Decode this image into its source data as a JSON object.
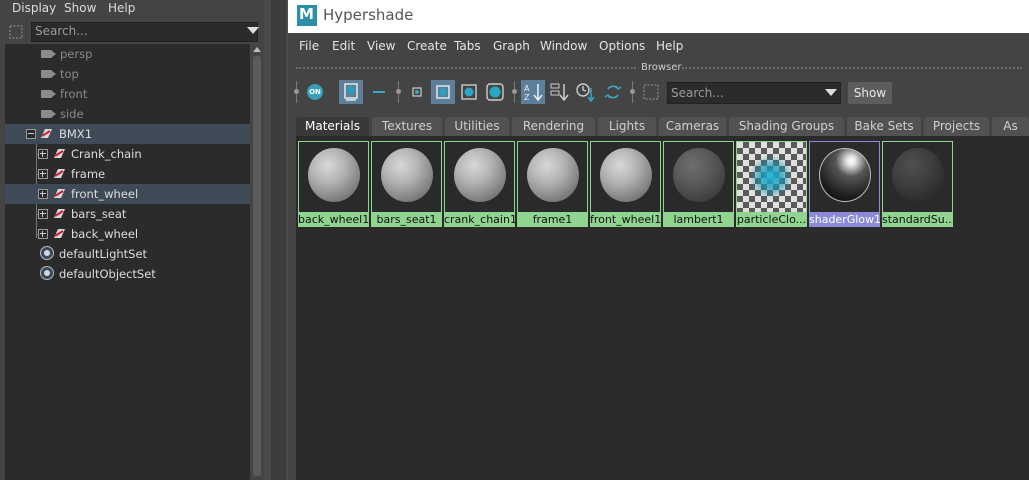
{
  "outliner": {
    "menu": [
      "Display",
      "Show",
      "Help"
    ],
    "search_placeholder": "Search...",
    "items": [
      {
        "label": "persp",
        "kind": "camera"
      },
      {
        "label": "top",
        "kind": "camera"
      },
      {
        "label": "front",
        "kind": "camera"
      },
      {
        "label": "side",
        "kind": "camera"
      },
      {
        "label": "BMX1",
        "kind": "group",
        "expanded": true,
        "selected": true
      },
      {
        "label": "Crank_chain",
        "kind": "transform"
      },
      {
        "label": "frame",
        "kind": "transform"
      },
      {
        "label": "front_wheel",
        "kind": "transform",
        "selected": true
      },
      {
        "label": "bars_seat",
        "kind": "transform"
      },
      {
        "label": "back_wheel",
        "kind": "transform"
      },
      {
        "label": "defaultLightSet",
        "kind": "set"
      },
      {
        "label": "defaultObjectSet",
        "kind": "set"
      }
    ]
  },
  "hypershade": {
    "title": "Hypershade",
    "logo_letter": "M",
    "menu": [
      "File",
      "Edit",
      "View",
      "Create",
      "Tabs",
      "Graph",
      "Window",
      "Options",
      "Help"
    ],
    "browser_label": "Browser",
    "toolbar_on_label": "ON",
    "search_placeholder": "Search...",
    "show_label": "Show",
    "tabs": [
      "Materials",
      "Textures",
      "Utilities",
      "Rendering",
      "Lights",
      "Cameras",
      "Shading Groups",
      "Bake Sets",
      "Projects",
      "As"
    ],
    "active_tab": "Materials",
    "materials": [
      {
        "label": "back_wheel1",
        "look": "light-sphere"
      },
      {
        "label": "bars_seat1",
        "look": "light-sphere"
      },
      {
        "label": "crank_chain1",
        "look": "light-sphere"
      },
      {
        "label": "frame1",
        "look": "light-sphere"
      },
      {
        "label": "front_wheel1",
        "look": "light-sphere"
      },
      {
        "label": "lambert1",
        "look": "dark-sphere"
      },
      {
        "label": "particleClo...",
        "look": "checker-glow"
      },
      {
        "label": "shaderGlow1",
        "look": "glossy-sphere",
        "selected": true
      },
      {
        "label": "standardSu...",
        "look": "darker-sphere"
      }
    ]
  },
  "colors": {
    "selected_material_label": "#8a8ad8",
    "material_label": "#8fd48f",
    "toolbar_active": "#5d7f9a",
    "maya_logo": "#2a8fa8"
  }
}
